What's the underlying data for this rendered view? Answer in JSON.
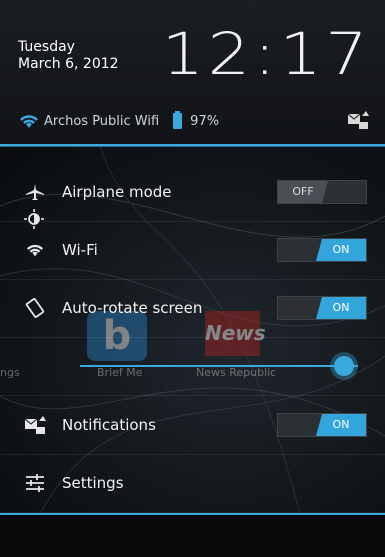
{
  "header": {
    "day": "Tuesday",
    "date": "March 6, 2012",
    "time": "12:17",
    "wifi_name": "Archos Public Wifi",
    "battery": "97%"
  },
  "background_apps": {
    "left_partial": "ngs",
    "app1": "Brief Me",
    "app2": "News Republic"
  },
  "rows": [
    {
      "label": "Airplane mode",
      "icon": "airplane-icon",
      "toggle": "OFF"
    },
    {
      "label": "Wi-Fi",
      "icon": "wifi-icon",
      "toggle": "ON"
    },
    {
      "label": "Auto-rotate screen",
      "icon": "rotate-icon",
      "toggle": "ON"
    },
    {
      "label": "Notifications",
      "icon": "notification-icon",
      "toggle": "ON"
    },
    {
      "label": "Settings",
      "icon": "sliders-icon"
    }
  ],
  "brightness": {
    "level": 0.95
  },
  "colors": {
    "accent": "#3aa9dd",
    "background": "#000000"
  }
}
